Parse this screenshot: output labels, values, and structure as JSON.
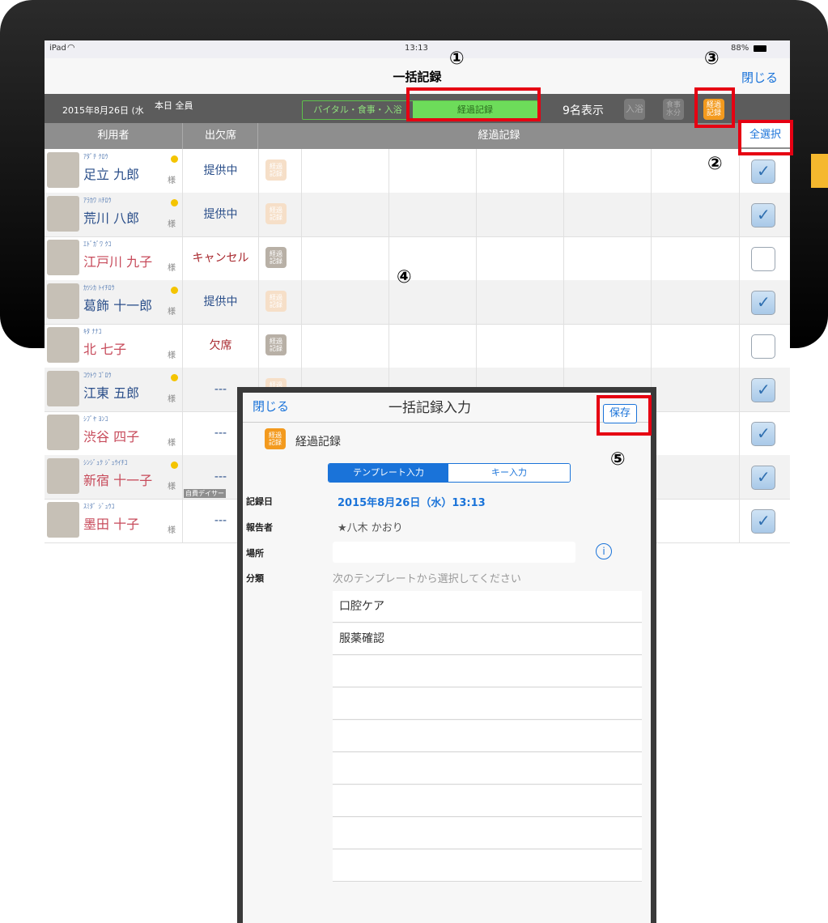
{
  "statusbar": {
    "carrier": "iPad",
    "time": "13:13",
    "battery": "88%"
  },
  "nav": {
    "title": "一括記録",
    "close": "閉じる"
  },
  "subbar": {
    "date": "2015年8月26日 (水",
    "scope": "本日 全員",
    "seg_vital": "バイタル・食事・入浴",
    "seg_progress": "経過記録",
    "count": "9名表示",
    "btn_bath": "入浴",
    "btn_meal_1": "食事",
    "btn_meal_2": "水分",
    "btn_progress_1": "経過",
    "btn_progress_2": "記録"
  },
  "header": {
    "user": "利用者",
    "attendance": "出欠席",
    "progress": "経過記録",
    "select_all": "全選択"
  },
  "badge": {
    "line1": "経過",
    "line2": "記録"
  },
  "honorific": "様",
  "rows": [
    {
      "kana": "ｱﾀﾞﾁ ｸﾛｳ",
      "name": "足立 九郎",
      "status": "提供中",
      "checked": true,
      "dot": true,
      "female": false
    },
    {
      "kana": "ｱﾗｶﾜ ﾊﾁﾛｳ",
      "name": "荒川 八郎",
      "status": "提供中",
      "checked": true,
      "dot": true,
      "female": false
    },
    {
      "kana": "ｴﾄﾞｶﾞﾜ ｸｺ",
      "name": "江戸川 九子",
      "status": "キャンセル",
      "checked": false,
      "dot": false,
      "female": true
    },
    {
      "kana": "ｶﾂｼｶ ﾄｲﾁﾛｳ",
      "name": "葛飾 十一郎",
      "status": "提供中",
      "checked": true,
      "dot": true,
      "female": false
    },
    {
      "kana": "ｷﾀ ﾅﾅｺ",
      "name": "北 七子",
      "status": "欠席",
      "checked": false,
      "dot": false,
      "female": true
    },
    {
      "kana": "ｺｳﾄｳ ｺﾞﾛｳ",
      "name": "江東 五郎",
      "status": "---",
      "checked": true,
      "dot": true,
      "female": false
    },
    {
      "kana": "ｼﾌﾞﾔ ﾖﾝｺ",
      "name": "渋谷 四子",
      "status": "---",
      "checked": true,
      "dot": false,
      "female": true
    },
    {
      "kana": "ｼﾝｼﾞｭｸ ｼﾞｭｳｲﾁｺ",
      "name": "新宿 十一子",
      "status": "---",
      "checked": true,
      "dot": true,
      "female": true,
      "note": "自費デイサー"
    },
    {
      "kana": "ｽﾐﾀﾞ ｼﾞｭｳｺ",
      "name": "墨田 十子",
      "status": "---",
      "checked": true,
      "dot": false,
      "female": true
    }
  ],
  "annotations": {
    "n1": "①",
    "n2": "②",
    "n3": "③",
    "n4": "④",
    "n5": "⑤"
  },
  "modal": {
    "close": "閉じる",
    "title": "一括記録入力",
    "save": "保存",
    "section": "経過記録",
    "tab_template": "テンプレート入力",
    "tab_key": "キー入力",
    "label_date": "記録日",
    "date_value": "2015年8月26日（水）13:13",
    "label_reporter": "報告者",
    "reporter_value": "★八木 かおり",
    "label_place": "場所",
    "label_category": "分類",
    "category_placeholder": "次のテンプレートから選択してください",
    "templates": [
      "口腔ケア",
      "服薬確認",
      "",
      "",
      "",
      "",
      "",
      "",
      ""
    ]
  },
  "colors": {
    "accent_blue": "#1a73d9",
    "green": "#6ddc5a",
    "orange": "#f39a1e",
    "red_annotation": "#e60012"
  }
}
